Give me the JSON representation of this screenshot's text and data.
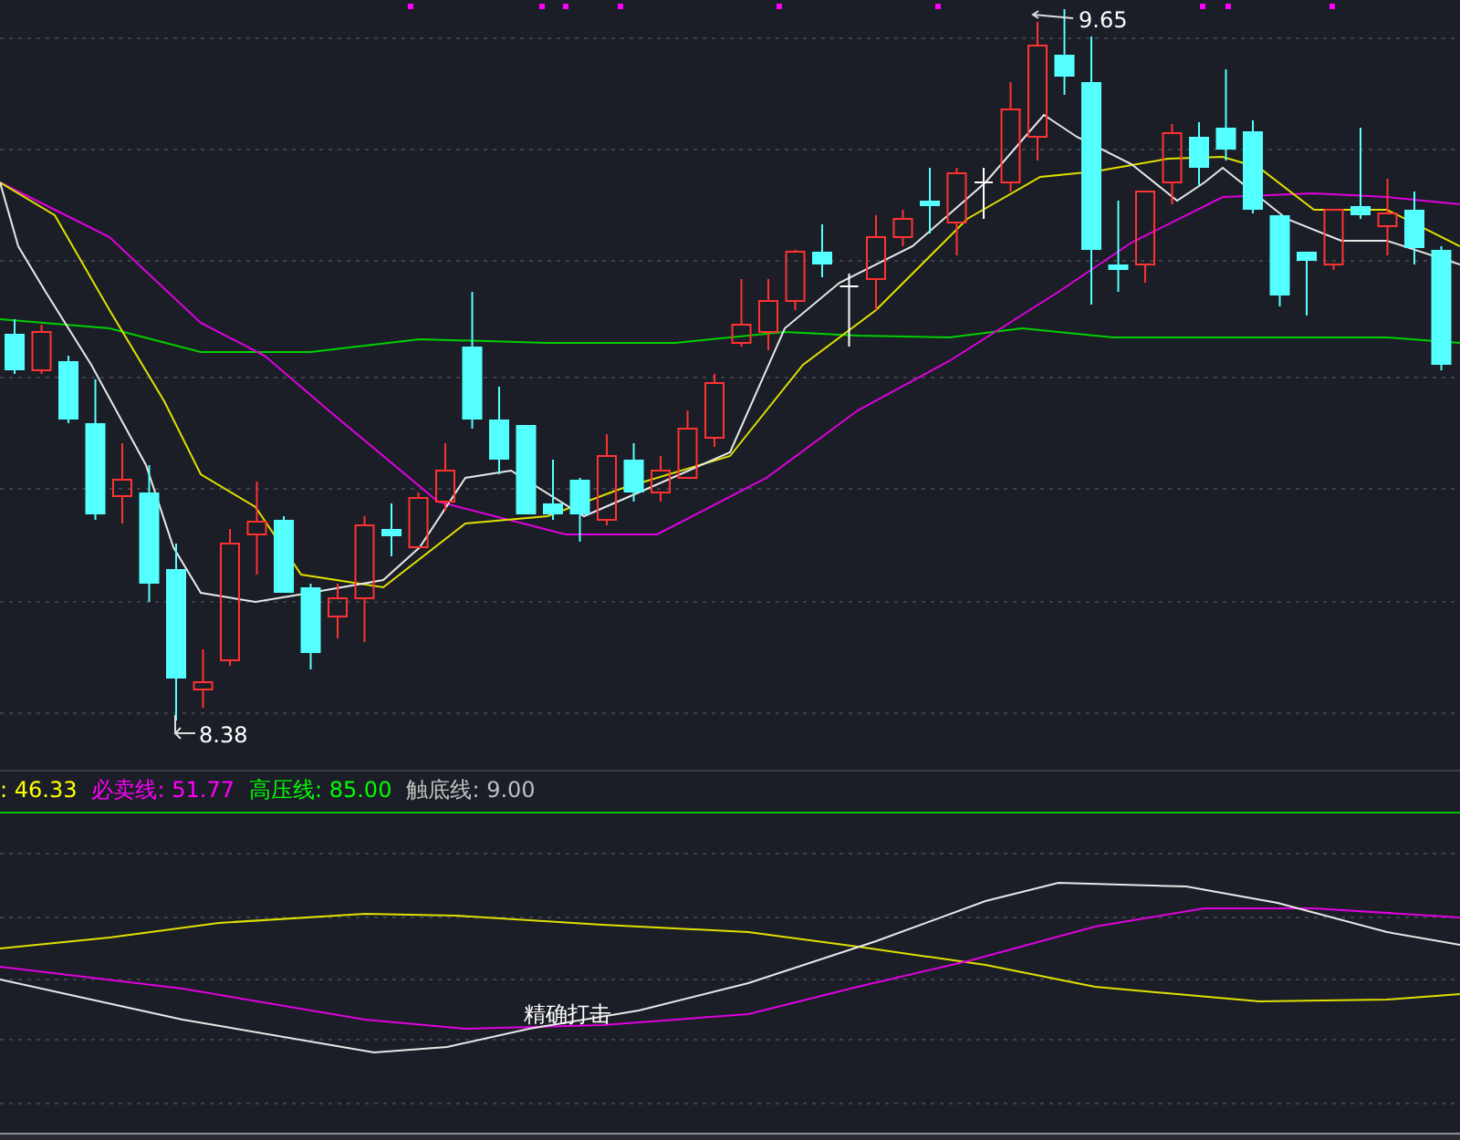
{
  "price_chart": {
    "high_label": "9.65",
    "low_label": "8.38"
  },
  "legend": [
    {
      "label": ":",
      "value": "46.33",
      "color": "#ffff00"
    },
    {
      "label": "必卖线:",
      "value": "51.77",
      "color": "#ff00ff"
    },
    {
      "label": "高压线:",
      "value": "85.00",
      "color": "#00ff00"
    },
    {
      "label": "触底线:",
      "value": "9.00",
      "color": "#c0c0c0"
    }
  ],
  "indicator_chart": {
    "signal_label": "精确打击"
  }
}
